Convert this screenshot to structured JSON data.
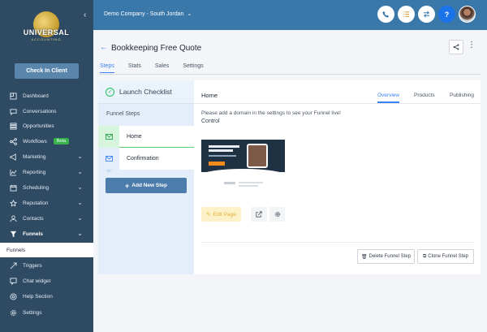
{
  "sidebar": {
    "logo": {
      "brand": "UNIVERSAL",
      "sub": "ACCOUNTING"
    },
    "checkin_label": "Check In Client",
    "items": [
      {
        "label": "Dashboard",
        "icon": "dashboard-icon",
        "chevron": false
      },
      {
        "label": "Conversations",
        "icon": "chat-icon",
        "chevron": false
      },
      {
        "label": "Opportunities",
        "icon": "funnel-list-icon",
        "chevron": false
      },
      {
        "label": "Workflows",
        "icon": "workflow-icon",
        "chevron": false,
        "badge": "Beta"
      },
      {
        "label": "Marketing",
        "icon": "megaphone-icon",
        "chevron": true
      },
      {
        "label": "Reporting",
        "icon": "chart-icon",
        "chevron": true
      },
      {
        "label": "Scheduling",
        "icon": "calendar-icon",
        "chevron": true
      },
      {
        "label": "Reputation",
        "icon": "star-icon",
        "chevron": true
      },
      {
        "label": "Contacts",
        "icon": "user-icon",
        "chevron": true
      },
      {
        "label": "Funnels",
        "icon": "filter-icon",
        "chevron": true,
        "active": true
      },
      {
        "label": "Funnels",
        "sub": true
      },
      {
        "label": "Triggers",
        "icon": "trigger-icon",
        "chevron": false
      },
      {
        "label": "Chat widget",
        "icon": "chat-widget-icon",
        "chevron": false
      },
      {
        "label": "Help Section",
        "icon": "help-icon",
        "chevron": false
      },
      {
        "label": "Settings",
        "icon": "gear-icon",
        "chevron": false
      }
    ]
  },
  "header": {
    "company": "Demo Company - South Jordan",
    "buttons": [
      {
        "name": "phone-button",
        "icon": "phone-icon",
        "color": "#ffffff"
      },
      {
        "name": "list-button",
        "icon": "list-icon",
        "color": "#ffffff"
      },
      {
        "name": "swap-button",
        "icon": "swap-icon",
        "color": "#ffffff"
      },
      {
        "name": "help-button",
        "icon": "question-icon",
        "color": "#1a73e8"
      }
    ]
  },
  "page": {
    "title": "Bookkeeping Free Quote",
    "tabs": [
      {
        "label": "Steps",
        "active": true
      },
      {
        "label": "Stats"
      },
      {
        "label": "Sales"
      },
      {
        "label": "Settings"
      }
    ]
  },
  "left_panel": {
    "checklist_label": "Launch Checklist",
    "steps_title": "Funnel Steps",
    "steps": [
      {
        "label": "Home",
        "active": true
      },
      {
        "label": "Confirmation"
      }
    ],
    "add_step_label": "Add New Step"
  },
  "right_panel": {
    "step_name": "Home",
    "tabs": [
      {
        "label": "Overview",
        "active": true
      },
      {
        "label": "Products"
      },
      {
        "label": "Publishing"
      }
    ],
    "notice": "Please add a domain in the settings to see your Funnel live!",
    "variant_label": "Control",
    "edit_label": "Edit Page",
    "delete_label": "Delete Funnel Step",
    "clone_label": "Clone Funnel Step"
  },
  "colors": {
    "sidebar": "#2f4a63",
    "topbar": "#3b78aa",
    "accent": "#3b82f6",
    "success": "#22c55e"
  }
}
